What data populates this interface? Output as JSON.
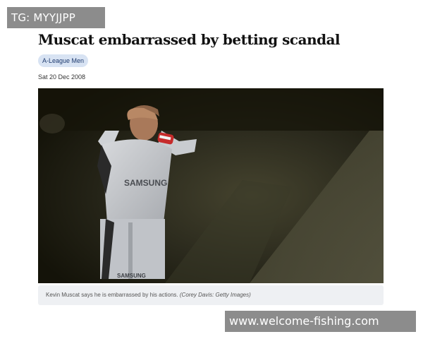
{
  "watermark_top": "TG: MYYJJPP",
  "watermark_bottom": "www.welcome-fishing.com",
  "article": {
    "headline": "Muscat embarrassed by betting scandal",
    "tag": "A-League Men",
    "date": "Sat 20 Dec 2008",
    "caption": "Kevin Muscat says he is embarrassed by his actions.",
    "caption_credit": "(Corey Davis: Getty Images)",
    "shirt_sponsor": "SAMSUNG",
    "shorts_sponsor": "SAMSUNG"
  },
  "colors": {
    "tag_bg": "#d8e3f3",
    "tag_text": "#1e3a6e",
    "caption_bg": "#eef0f3",
    "watermark_bg": "#8c8c8c"
  }
}
